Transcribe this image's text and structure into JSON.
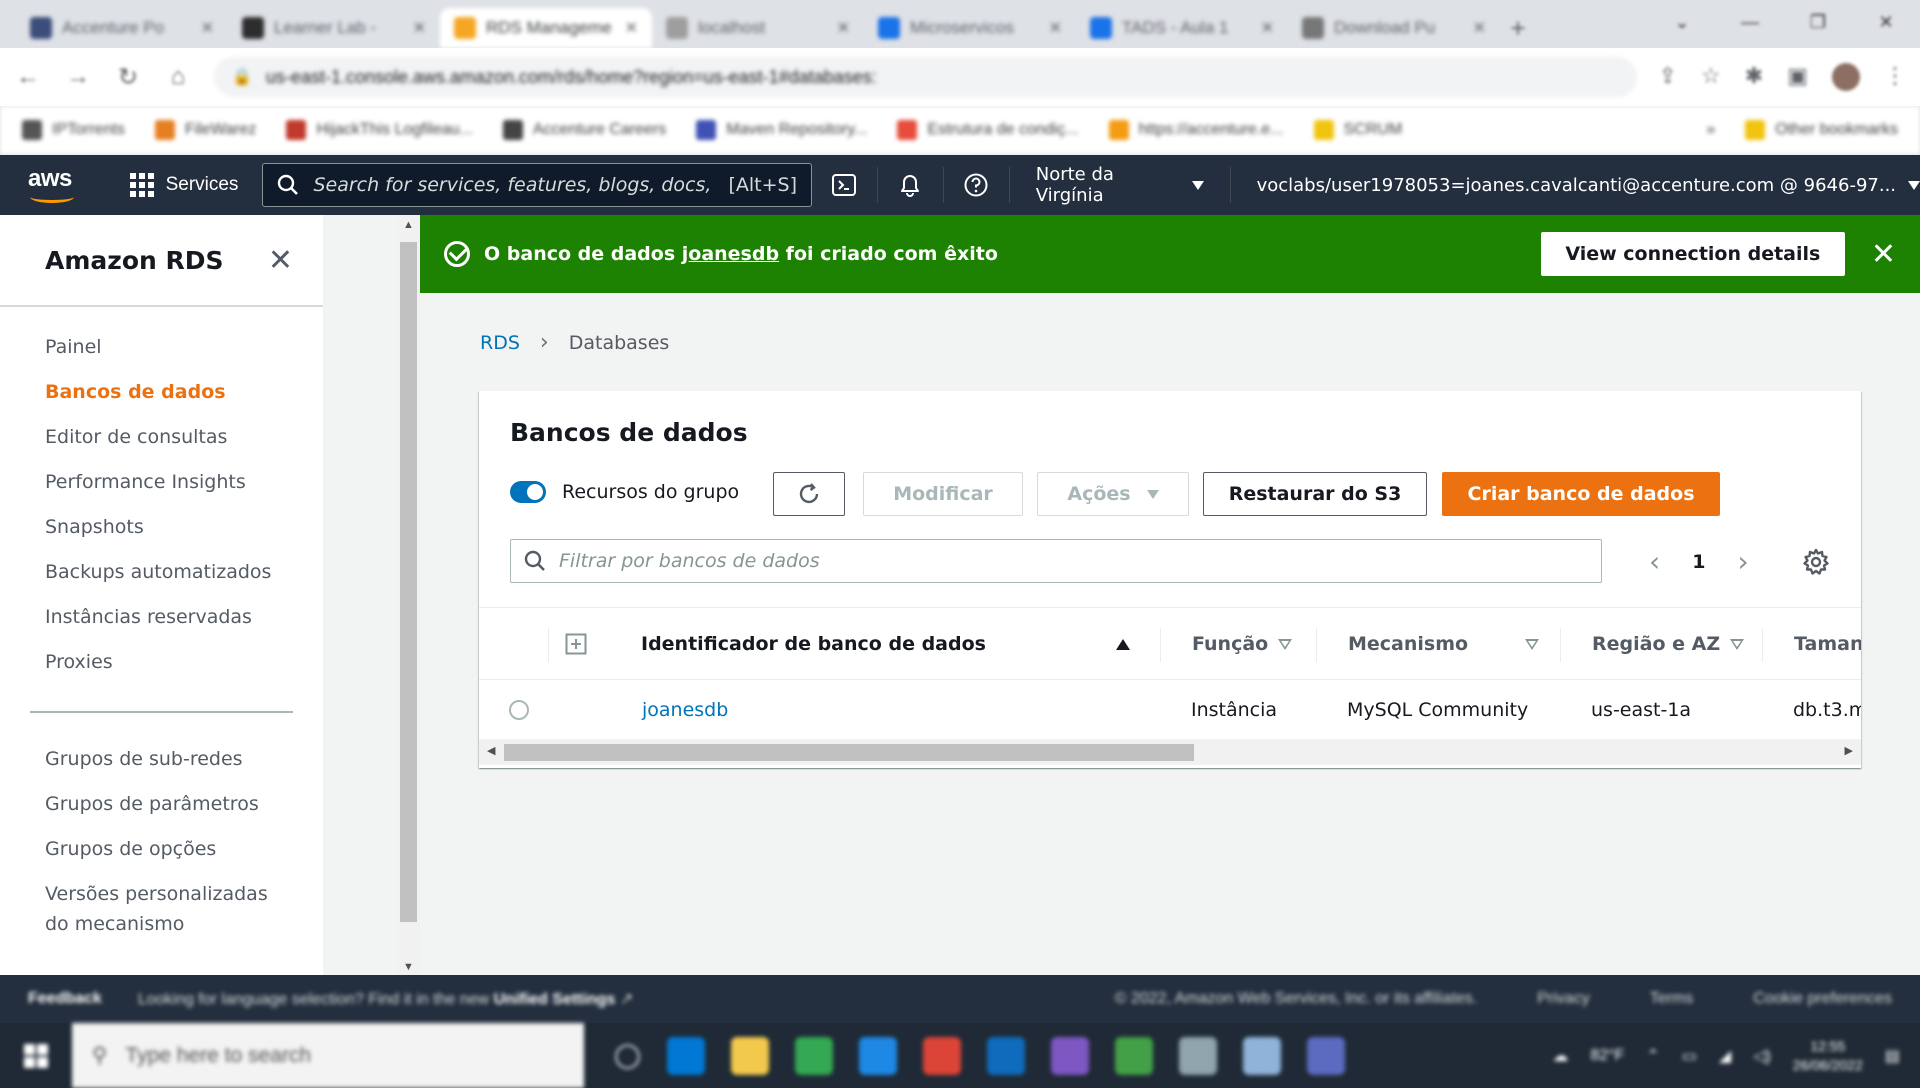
{
  "browser": {
    "tabs": [
      {
        "label": "Accenture Po",
        "color": "#3b4d7a",
        "active": false
      },
      {
        "label": "Learner Lab -",
        "color": "#2d2d2d",
        "active": false
      },
      {
        "label": "RDS Manageme",
        "color": "#f5a623",
        "active": true
      },
      {
        "label": "localhost",
        "color": "#9e9e9e",
        "active": false
      },
      {
        "label": "Microservicos",
        "color": "#1a73e8",
        "active": false
      },
      {
        "label": "TADS - Aula 1",
        "color": "#1a73e8",
        "active": false
      },
      {
        "label": "Download Pu",
        "color": "#777777",
        "active": false
      }
    ],
    "url": "us-east-1.console.aws.amazon.com/rds/home?region=us-east-1#databases:",
    "bookmarks": [
      {
        "label": "IPTorrents",
        "color": "#555555"
      },
      {
        "label": "FileWarez",
        "color": "#e67e22"
      },
      {
        "label": "HijackThis Logfileau...",
        "color": "#c0392b"
      },
      {
        "label": "Accenture Careers",
        "color": "#444444"
      },
      {
        "label": "Maven Repository...",
        "color": "#3f51b5"
      },
      {
        "label": "Estrutura de condiç...",
        "color": "#e74c3c"
      },
      {
        "label": "https://accenture.e...",
        "color": "#f39c12"
      },
      {
        "label": "SCRUM",
        "color": "#f1c40f"
      }
    ],
    "other_bookmarks": "Other bookmarks"
  },
  "aws_nav": {
    "logo": "aws",
    "services_label": "Services",
    "search_placeholder": "Search for services, features, blogs, docs, and",
    "search_shortcut": "[Alt+S]",
    "region": "Norte da Virgínia",
    "account": "voclabs/user1978053=joanes.cavalcanti@accenture.com @ 9646-97..."
  },
  "sidebar": {
    "title": "Amazon RDS",
    "items": [
      {
        "label": "Painel",
        "active": false
      },
      {
        "label": "Bancos de dados",
        "active": true
      },
      {
        "label": "Editor de consultas",
        "active": false
      },
      {
        "label": "Performance Insights",
        "active": false
      },
      {
        "label": "Snapshots",
        "active": false
      },
      {
        "label": "Backups automatizados",
        "active": false
      },
      {
        "label": "Instâncias reservadas",
        "active": false
      },
      {
        "label": "Proxies",
        "active": false
      }
    ],
    "items2": [
      {
        "label": "Grupos de sub-redes"
      },
      {
        "label": "Grupos de parâmetros"
      },
      {
        "label": "Grupos de opções"
      },
      {
        "label": "Versões personalizadas do mecanismo"
      }
    ]
  },
  "flash": {
    "prefix": "O banco de dados ",
    "db_link": "joanesdb",
    "suffix": " foi criado com êxito",
    "button": "View connection details",
    "color": "#1d8102"
  },
  "breadcrumb": {
    "root": "RDS",
    "current": "Databases"
  },
  "panel": {
    "title": "Bancos de dados",
    "toggle_label": "Recursos do grupo",
    "buttons": {
      "modify": "Modificar",
      "actions": "Ações",
      "restore": "Restaurar do S3",
      "create": "Criar banco de dados"
    },
    "filter_placeholder": "Filtrar por bancos de dados",
    "page": "1",
    "columns": {
      "identifier": "Identificador de banco de dados",
      "role": "Função",
      "engine": "Mecanismo",
      "region": "Região e AZ",
      "size": "Taman"
    },
    "rows": [
      {
        "identifier": "joanesdb",
        "role": "Instância",
        "engine": "MySQL Community",
        "region": "us-east-1a",
        "size": "db.t3.m"
      }
    ]
  },
  "footer": {
    "feedback": "Feedback",
    "language_note": "Looking for language selection? Find it in the new",
    "unified_settings": "Unified Settings",
    "copyright": "© 2022, Amazon Web Services, Inc. or its affiliates.",
    "privacy": "Privacy",
    "terms": "Terms",
    "cookies": "Cookie preferences"
  },
  "taskbar": {
    "search_placeholder": "Type here to search",
    "apps": [
      "#0078d4",
      "#f2c94c",
      "#34a853",
      "#1e88e5",
      "#db4437",
      "#0f6cbd",
      "#7e57c2",
      "#43a047",
      "#90a4ae",
      "#8fb3d9",
      "#5c6bc0"
    ],
    "temperature": "82°F",
    "time": "12:55",
    "date": "26/06/2022"
  },
  "colors": {
    "accent": "#ec7211",
    "link": "#0073bb",
    "nav_bg": "#232f3e"
  }
}
